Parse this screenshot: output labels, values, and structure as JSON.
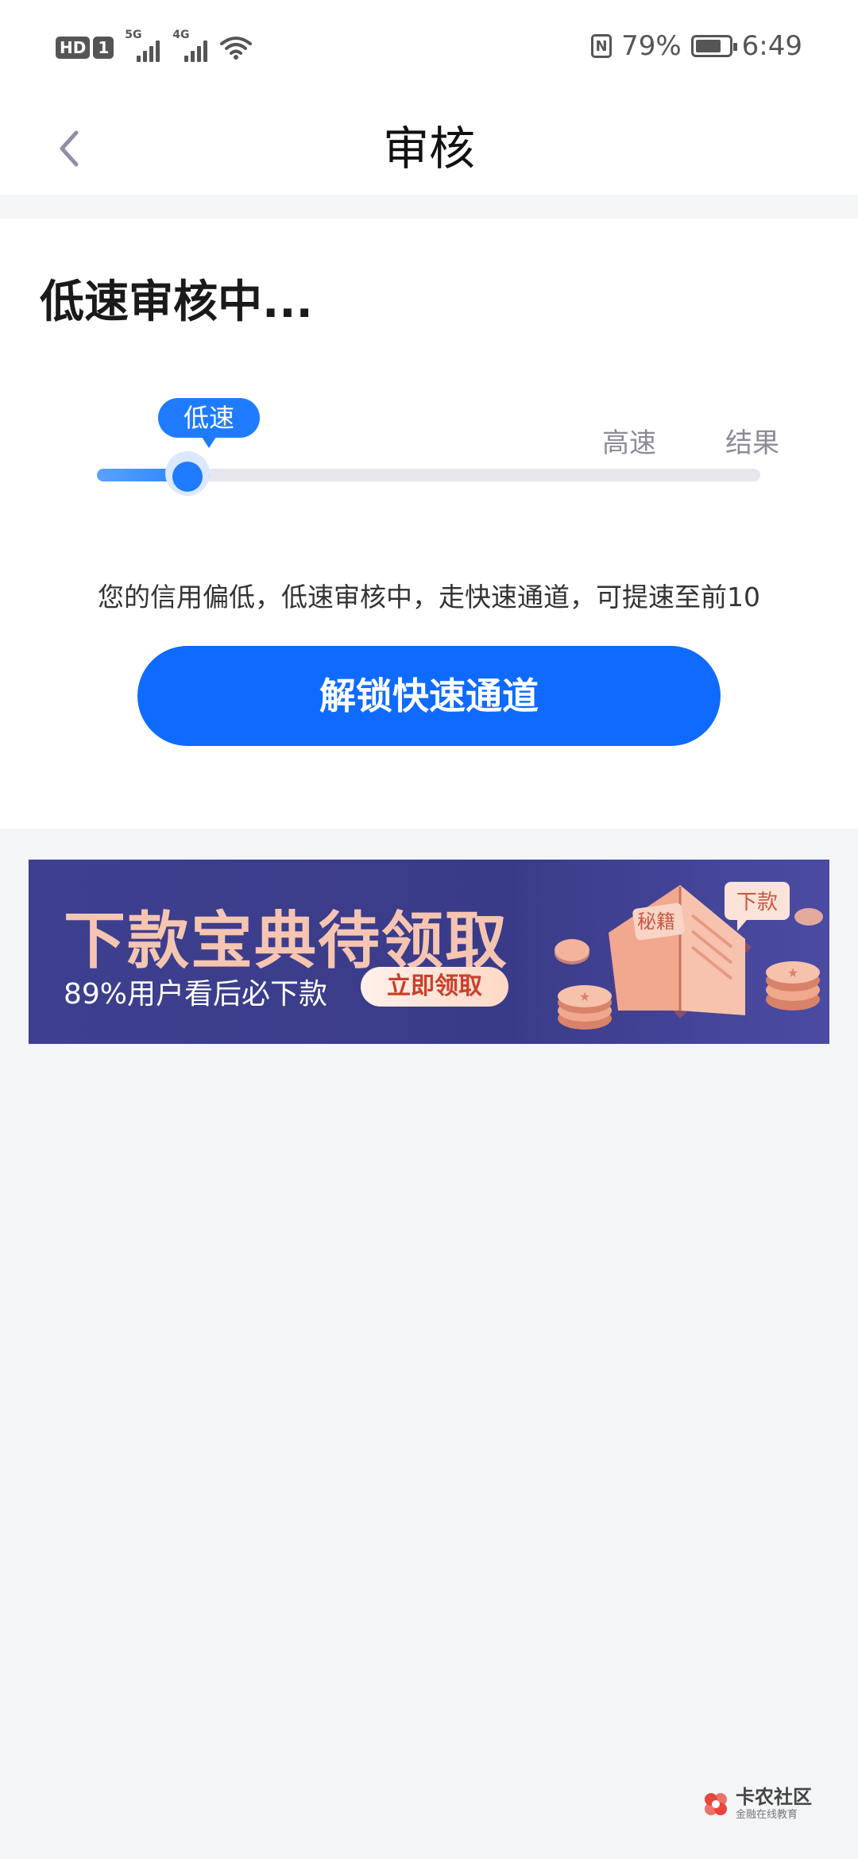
{
  "status_bar": {
    "hd": "HD",
    "sim": "1",
    "net1": "5G",
    "net2": "4G",
    "battery_percent": "79%",
    "battery_level": 0.79,
    "time": "6:49"
  },
  "header": {
    "title": "审核"
  },
  "review": {
    "heading": "低速审核中...",
    "current_stage": "低速",
    "stages": [
      "高速",
      "结果"
    ],
    "progress": 0.17,
    "hint": "您的信用偏低，低速审核中，走快速通道，可提速至前10",
    "unlock_button": "解锁快速通道"
  },
  "banner": {
    "title": "下款宝典待领取",
    "subtitle": "89%用户看后必下款",
    "button": "立即领取",
    "book_tag": "秘籍",
    "bubble_tag": "下款"
  },
  "watermark": {
    "name": "卡农社区",
    "sub": "金融在线教育"
  },
  "colors": {
    "accent": "#0f6bff",
    "banner_bg": "#3e3f8f",
    "banner_title": "#f6c5b1"
  }
}
